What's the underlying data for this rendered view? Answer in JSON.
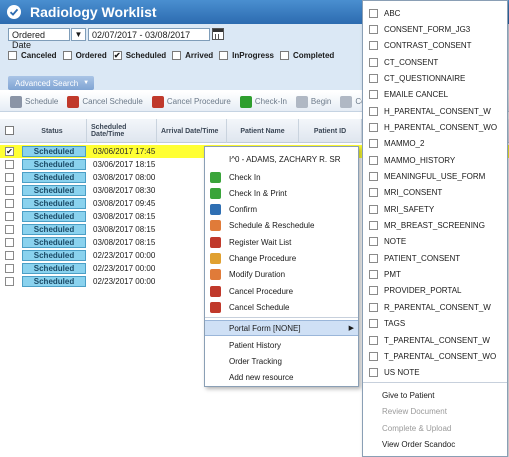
{
  "app": {
    "title": "Radiology Worklist"
  },
  "filters": {
    "date_type": "Ordered Date",
    "date_range": "02/07/2017 - 03/08/2017",
    "statuses": [
      {
        "label": "Canceled",
        "checked": false
      },
      {
        "label": "Ordered",
        "checked": false
      },
      {
        "label": "Scheduled",
        "checked": true
      },
      {
        "label": "Arrived",
        "checked": false
      },
      {
        "label": "InProgress",
        "checked": false
      },
      {
        "label": "Completed",
        "checked": false
      }
    ]
  },
  "advanced_search": {
    "label": "Advanced Search"
  },
  "toolbar": {
    "items": [
      {
        "label": "Schedule",
        "icon": "calendar-icon",
        "color": "#8a94a6"
      },
      {
        "label": "Cancel Schedule",
        "icon": "cancel-schedule-icon",
        "color": "#c0392b"
      },
      {
        "label": "Cancel Procedure",
        "icon": "cancel-procedure-icon",
        "color": "#c0392b"
      },
      {
        "label": "Check-In",
        "icon": "check-in-icon",
        "color": "#2e9e2e"
      },
      {
        "label": "Begin",
        "icon": "begin-icon",
        "color": "#b0b8c4"
      },
      {
        "label": "Comple",
        "icon": "complete-icon",
        "color": "#b0b8c4"
      }
    ]
  },
  "grid": {
    "columns": [
      "Status",
      "Scheduled Date/Time",
      "Arrival Date/Time",
      "Patient Name",
      "Patient ID"
    ],
    "rows": [
      {
        "status": "Scheduled",
        "scheduled": "03/06/2017 17:45",
        "selected": true
      },
      {
        "status": "Scheduled",
        "scheduled": "03/06/2017 18:15",
        "selected": false
      },
      {
        "status": "Scheduled",
        "scheduled": "03/08/2017 08:00",
        "selected": false
      },
      {
        "status": "Scheduled",
        "scheduled": "03/08/2017 08:30",
        "selected": false
      },
      {
        "status": "Scheduled",
        "scheduled": "03/08/2017 09:45",
        "selected": false
      },
      {
        "status": "Scheduled",
        "scheduled": "03/08/2017 08:15",
        "selected": false
      },
      {
        "status": "Scheduled",
        "scheduled": "03/08/2017 08:15",
        "selected": false
      },
      {
        "status": "Scheduled",
        "scheduled": "03/08/2017 08:15",
        "selected": false
      },
      {
        "status": "Scheduled",
        "scheduled": "02/23/2017 00:00",
        "selected": false
      },
      {
        "status": "Scheduled",
        "scheduled": "02/23/2017 00:00",
        "selected": false
      },
      {
        "status": "Scheduled",
        "scheduled": "02/23/2017 00:00",
        "selected": false
      }
    ]
  },
  "context_menu": {
    "header": "I^0 - ADAMS, ZACHARY R. SR",
    "items": [
      {
        "label": "Check In",
        "icon": "check-in-icon",
        "color": "#3aa43a"
      },
      {
        "label": "Check In & Print",
        "icon": "check-in-print-icon",
        "color": "#3aa43a"
      },
      {
        "label": "Confirm",
        "icon": "confirm-icon",
        "color": "#2f6fb3"
      },
      {
        "label": "Schedule & Reschedule",
        "icon": "reschedule-icon",
        "color": "#e07b39"
      },
      {
        "label": "Register Wait List",
        "icon": "wait-list-icon",
        "color": "#c0392b"
      },
      {
        "label": "Change Procedure",
        "icon": "change-procedure-icon",
        "color": "#e0a030"
      },
      {
        "label": "Modify Duration",
        "icon": "modify-duration-icon",
        "color": "#e07b39"
      },
      {
        "label": "Cancel Procedure",
        "icon": "cancel-procedure-icon",
        "color": "#c0392b"
      },
      {
        "label": "Cancel Schedule",
        "icon": "cancel-schedule-icon",
        "color": "#c0392b"
      }
    ],
    "portal_form": "Portal Form [NONE]",
    "footer_items": [
      "Patient History",
      "Order Tracking",
      "Add new resource"
    ]
  },
  "portal_submenu": {
    "items": [
      "ABC",
      "CONSENT_FORM_JG3",
      "CONTRAST_CONSENT",
      "CT_CONSENT",
      "CT_QUESTIONNAIRE",
      "EMAILE CANCEL",
      "H_PARENTAL_CONSENT_W",
      "H_PARENTAL_CONSENT_WO",
      "MAMMO_2",
      "MAMMO_HISTORY",
      "MEANINGFUL_USE_FORM",
      "MRI_CONSENT",
      "MRI_SAFETY",
      "MR_BREAST_SCREENING",
      "NOTE",
      "PATIENT_CONSENT",
      "PMT",
      "PROVIDER_PORTAL",
      "R_PARENTAL_CONSENT_W",
      "TAGS",
      "T_PARENTAL_CONSENT_W",
      "T_PARENTAL_CONSENT_WO",
      "US NOTE"
    ],
    "actions": [
      {
        "label": "Give to Patient",
        "enabled": true
      },
      {
        "label": "Review Document",
        "enabled": false
      },
      {
        "label": "Complete & Upload",
        "enabled": false
      },
      {
        "label": "View Order Scandoc",
        "enabled": true
      }
    ]
  },
  "colors": {
    "title_bar": "#3a7cc2",
    "selected_row": "#ffff33",
    "status_badge": "#8ad2ee"
  }
}
